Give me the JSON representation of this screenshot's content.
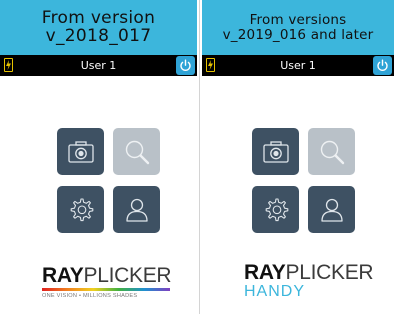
{
  "left": {
    "header_line1": "From version",
    "header_line2": "v_2018_017",
    "user_label": "User 1",
    "logo_ray": "RAY",
    "logo_plicker": "PLICKER",
    "tagline": "ONE VISION • MILLIONS SHADES"
  },
  "right": {
    "header_line1": "From versions",
    "header_line2": "v_2019_016 and later",
    "user_label": "User 1",
    "logo_ray": "RAY",
    "logo_plicker": "PLICKER",
    "logo_sub": "HANDY"
  },
  "colors": {
    "header_bg": "#3cb6dc",
    "status_bg": "#000000",
    "tile_dark": "#3e5163",
    "tile_light": "#b9c1c8",
    "power_button": "#2fa3d6",
    "battery": "#e6c200"
  },
  "icons": [
    "battery-icon",
    "power-icon",
    "camera-icon",
    "search-icon",
    "gear-icon",
    "user-icon"
  ]
}
